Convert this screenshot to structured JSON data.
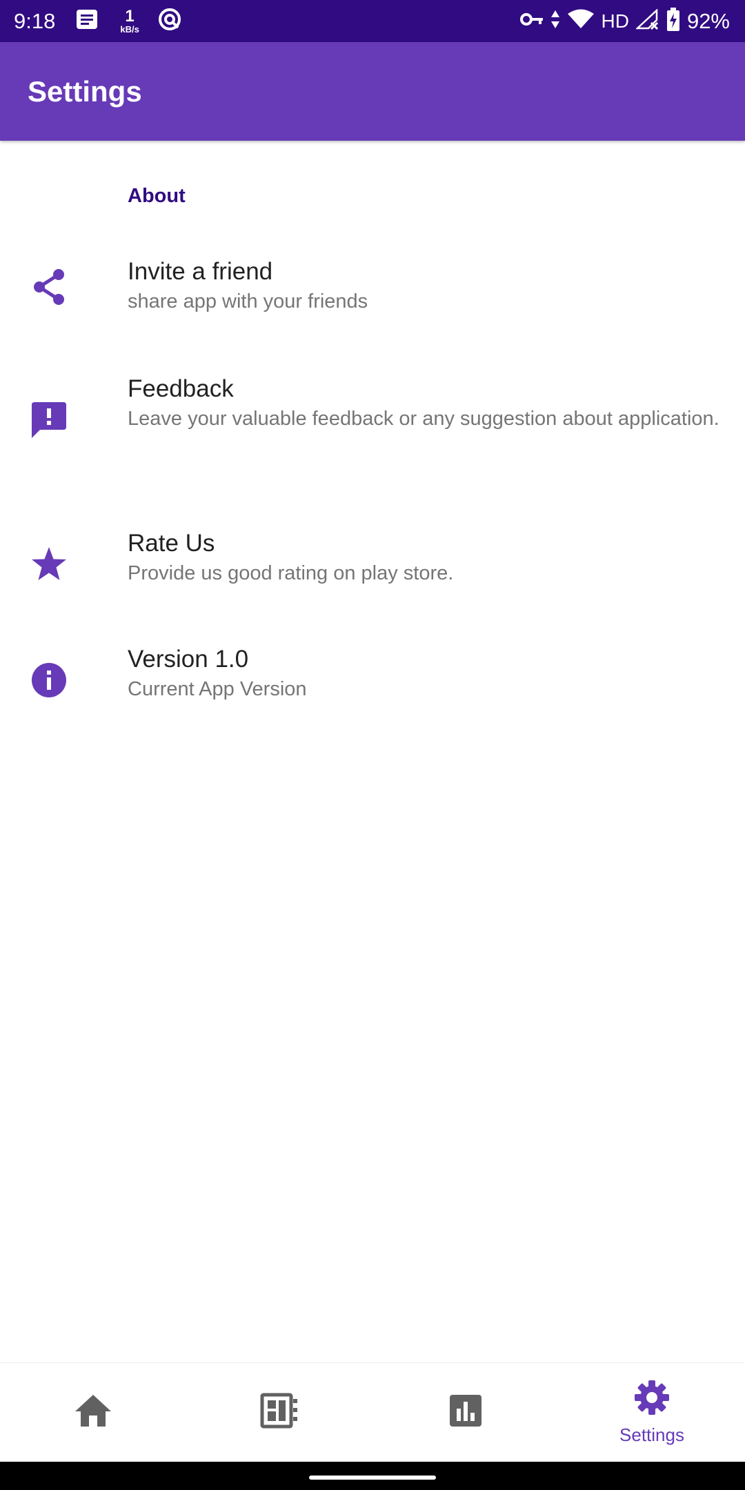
{
  "status_bar": {
    "time": "9:18",
    "net_speed_value": "1",
    "net_speed_unit": "kB/s",
    "network_label": "HD",
    "battery": "92%"
  },
  "app_bar": {
    "title": "Settings"
  },
  "preferences": {
    "section_title": "About",
    "items": [
      {
        "title": "Invite a friend",
        "summary": "share app with your friends",
        "icon": "share-icon"
      },
      {
        "title": "Feedback",
        "summary": "Leave your valuable feedback or any suggestion about application.",
        "icon": "feedback-icon"
      },
      {
        "title": "Rate Us",
        "summary": "Provide us good rating on play store.",
        "icon": "star-icon"
      },
      {
        "title": "Version 1.0",
        "summary": "Current App Version",
        "icon": "info-icon"
      }
    ]
  },
  "bottom_nav": {
    "items": [
      {
        "icon": "home-icon",
        "label": ""
      },
      {
        "icon": "dashboard-icon",
        "label": ""
      },
      {
        "icon": "chart-icon",
        "label": ""
      },
      {
        "icon": "gear-icon",
        "label": "Settings",
        "selected": true
      }
    ]
  },
  "colors": {
    "status_bar": "#310b82",
    "primary": "#673ab7",
    "section_header": "#310b82",
    "title_text": "#212121",
    "summary_text": "#757575",
    "nav_icon_inactive": "#616161"
  }
}
